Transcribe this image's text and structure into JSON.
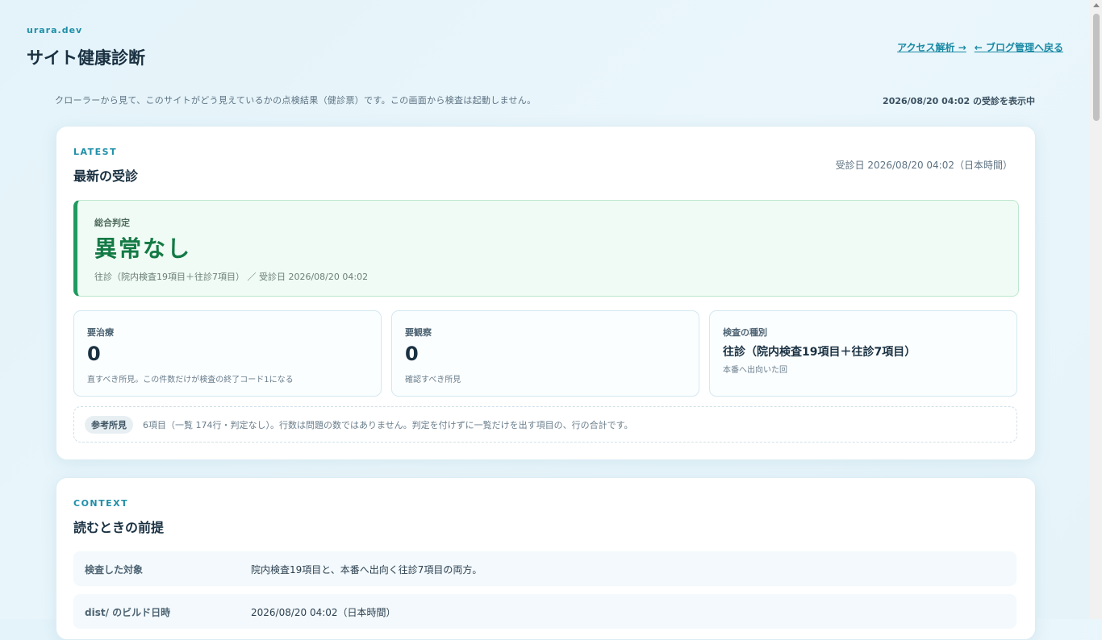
{
  "header": {
    "brand": "urara.dev",
    "title": "サイト健康診断",
    "links": [
      "アクセス解析 →",
      "← ブログ管理へ戻る"
    ]
  },
  "intro": "クローラーから見て、このサイトがどう見えているかの点検結果（健診票）です。この画面から検査は起動しません。",
  "status": "2026/08/20 04:02 の受診を表示中",
  "latest": {
    "eyebrow": "LATEST",
    "title": "最新の受診",
    "exam_date": "受診日 2026/08/20 04:02（日本時間）",
    "verdict": {
      "label": "総合判定",
      "value": "異常なし",
      "meta": "往診（院内検査19項目＋往診7項目） ／ 受診日 2026/08/20 04:02"
    },
    "stats": [
      {
        "label": "要治療",
        "value": "0",
        "note": "直すべき所見。この件数だけが検査の終了コード1になる"
      },
      {
        "label": "要観察",
        "value": "0",
        "note": "確認すべき所見"
      },
      {
        "label": "検査の種別",
        "value": "往診（院内検査19項目＋往診7項目）",
        "note": "本番へ出向いた回"
      }
    ],
    "reference": {
      "badge": "参考所見",
      "text": "6項目（一覧 174行・判定なし）。行数は問題の数ではありません。判定を付けずに一覧だけを出す項目の、行の合計です。"
    }
  },
  "context": {
    "eyebrow": "CONTEXT",
    "title": "読むときの前提",
    "rows": [
      {
        "key": "検査した対象",
        "value": "院内検査19項目と、本番へ出向く往診7項目の両方。"
      },
      {
        "key": "dist/ のビルド日時",
        "value": "2026/08/20 04:02（日本時間）"
      }
    ]
  }
}
